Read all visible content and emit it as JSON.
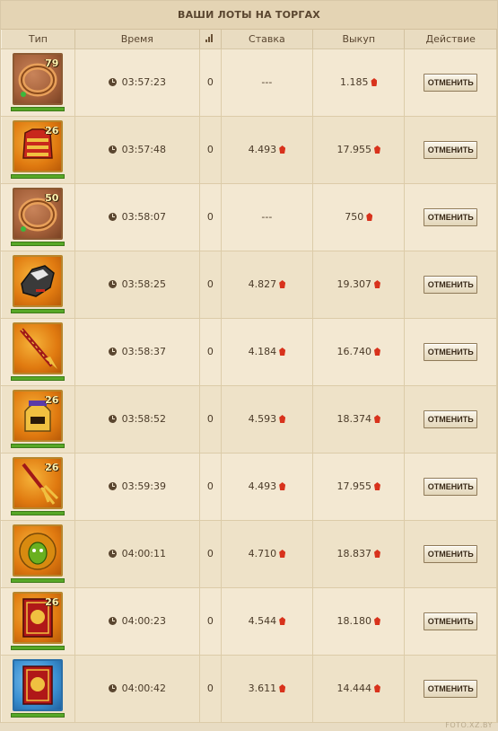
{
  "title": "ВАШИ ЛОТЫ НА ТОРГАХ",
  "columns": {
    "type": "Тип",
    "time": "Время",
    "stake": "Ставка",
    "buyout": "Выкуп",
    "action": "Действие"
  },
  "colors": {
    "ruby": "#d8321c",
    "level_text": "#fff3b0",
    "durability_bar": "#57a827"
  },
  "rows": [
    {
      "icon": "ring-icon",
      "level": "79",
      "time": "03:57:23",
      "bids": "0",
      "stake": "---",
      "buyout": "1.185",
      "action": "ОТМЕНИТЬ"
    },
    {
      "icon": "armor-icon",
      "level": "26",
      "time": "03:57:48",
      "bids": "0",
      "stake": "4.493",
      "buyout": "17.955",
      "action": "ОТМЕНИТЬ"
    },
    {
      "icon": "ring-icon",
      "level": "50",
      "time": "03:58:07",
      "bids": "0",
      "stake": "---",
      "buyout": "750",
      "action": "ОТМЕНИТЬ"
    },
    {
      "icon": "gauntlet-icon",
      "level": "",
      "time": "03:58:25",
      "bids": "0",
      "stake": "4.827",
      "buyout": "19.307",
      "action": "ОТМЕНИТЬ"
    },
    {
      "icon": "sword-icon",
      "level": "",
      "time": "03:58:37",
      "bids": "0",
      "stake": "4.184",
      "buyout": "16.740",
      "action": "ОТМЕНИТЬ"
    },
    {
      "icon": "helmet-icon",
      "level": "26",
      "time": "03:58:52",
      "bids": "0",
      "stake": "4.593",
      "buyout": "18.374",
      "action": "ОТМЕНИТЬ"
    },
    {
      "icon": "trident-dagger-icon",
      "level": "26",
      "time": "03:59:39",
      "bids": "0",
      "stake": "4.493",
      "buyout": "17.955",
      "action": "ОТМЕНИТЬ"
    },
    {
      "icon": "mask-icon",
      "level": "",
      "time": "04:00:11",
      "bids": "0",
      "stake": "4.710",
      "buyout": "18.837",
      "action": "ОТМЕНИТЬ"
    },
    {
      "icon": "book-icon",
      "level": "26",
      "time": "04:00:23",
      "bids": "0",
      "stake": "4.544",
      "buyout": "18.180",
      "action": "ОТМЕНИТЬ"
    },
    {
      "icon": "book-icon",
      "level": "",
      "time": "04:00:42",
      "bids": "0",
      "stake": "3.611",
      "buyout": "14.444",
      "action": "ОТМЕНИТЬ"
    }
  ],
  "watermark": "FOTO.XZ.BY"
}
